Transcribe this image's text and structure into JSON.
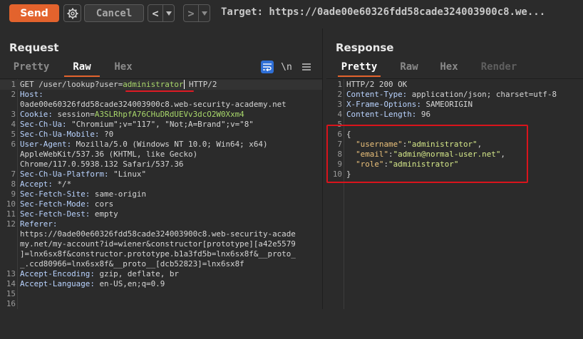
{
  "toolbar": {
    "send_label": "Send",
    "cancel_label": "Cancel",
    "back_label": "<",
    "forward_label": ">",
    "target_text": "Target: https://0ade00e60326fdd58cade324003900c8.we..."
  },
  "request": {
    "title": "Request",
    "tabs": [
      {
        "label": "Pretty"
      },
      {
        "label": "Raw"
      },
      {
        "label": "Hex"
      }
    ],
    "newline_toggle": "\\n",
    "lines": [
      {
        "n": "1",
        "text": "GET /user/lookup?user=",
        "param": "administrator",
        "tail": " HTTP/2"
      },
      {
        "n": "2",
        "name": "Host:",
        "value": ""
      },
      {
        "n": "",
        "text": "0ade00e60326fdd58cade324003900c8.web-security-academy.net"
      },
      {
        "n": "3",
        "name": "Cookie:",
        "value": " session=",
        "green": "A3SLRhpfA76CHuDRdUEVv3dcO2W0Xxm4"
      },
      {
        "n": "4",
        "name": "Sec-Ch-Ua:",
        "value": " \"Chromium\";v=\"117\", \"Not;A=Brand\";v=\"8\""
      },
      {
        "n": "5",
        "name": "Sec-Ch-Ua-Mobile:",
        "value": " ?0"
      },
      {
        "n": "6",
        "name": "User-Agent:",
        "value": " Mozilla/5.0 (Windows NT 10.0; Win64; x64)"
      },
      {
        "n": "",
        "text": "AppleWebKit/537.36 (KHTML, like Gecko)"
      },
      {
        "n": "",
        "text": "Chrome/117.0.5938.132 Safari/537.36"
      },
      {
        "n": "7",
        "name": "Sec-Ch-Ua-Platform:",
        "value": " \"Linux\""
      },
      {
        "n": "8",
        "name": "Accept:",
        "value": " */*"
      },
      {
        "n": "9",
        "name": "Sec-Fetch-Site:",
        "value": " same-origin"
      },
      {
        "n": "10",
        "name": "Sec-Fetch-Mode:",
        "value": " cors"
      },
      {
        "n": "11",
        "name": "Sec-Fetch-Dest:",
        "value": " empty"
      },
      {
        "n": "12",
        "name": "Referer:",
        "value": ""
      },
      {
        "n": "",
        "text": "https://0ade00e60326fdd58cade324003900c8.web-security-acade"
      },
      {
        "n": "",
        "text": "my.net/my-account?id=wiener&constructor[prototype][a42e5579"
      },
      {
        "n": "",
        "text": "]=lnx6sx8f&constructor.prototype.b1a3fd5b=lnx6sx8f&__proto_"
      },
      {
        "n": "",
        "text": "_.ccd80966=lnx6sx8f&__proto__[dcb52823]=lnx6sx8f"
      },
      {
        "n": "13",
        "name": "Accept-Encoding:",
        "value": " gzip, deflate, br"
      },
      {
        "n": "14",
        "name": "Accept-Language:",
        "value": " en-US,en;q=0.9"
      },
      {
        "n": "15",
        "text": ""
      },
      {
        "n": "16",
        "text": ""
      }
    ]
  },
  "response": {
    "title": "Response",
    "tabs": [
      {
        "label": "Pretty"
      },
      {
        "label": "Raw"
      },
      {
        "label": "Hex"
      },
      {
        "label": "Render"
      }
    ],
    "lines": [
      {
        "n": "1",
        "text": "HTTP/2 200 OK"
      },
      {
        "n": "2",
        "name": "Content-Type:",
        "value": " application/json; charset=utf-8"
      },
      {
        "n": "3",
        "name": "X-Frame-Options:",
        "value": " SAMEORIGIN"
      },
      {
        "n": "4",
        "name": "Content-Length:",
        "value": " 96"
      },
      {
        "n": "5",
        "text": ""
      },
      {
        "n": "6",
        "text": "{"
      },
      {
        "n": "7",
        "key": "\"username\"",
        "val": "\"administrator\"",
        "end": ","
      },
      {
        "n": "8",
        "key": "\"email\"",
        "val": "\"admin@normal-user.net\"",
        "end": ","
      },
      {
        "n": "9",
        "key": "\"role\"",
        "val": "\"administrator\"",
        "end": ""
      },
      {
        "n": "10",
        "text": "}"
      }
    ]
  },
  "colors": {
    "accent": "#e3632d",
    "annotation_red": "#d9141c",
    "background": "#2b2b2b"
  }
}
